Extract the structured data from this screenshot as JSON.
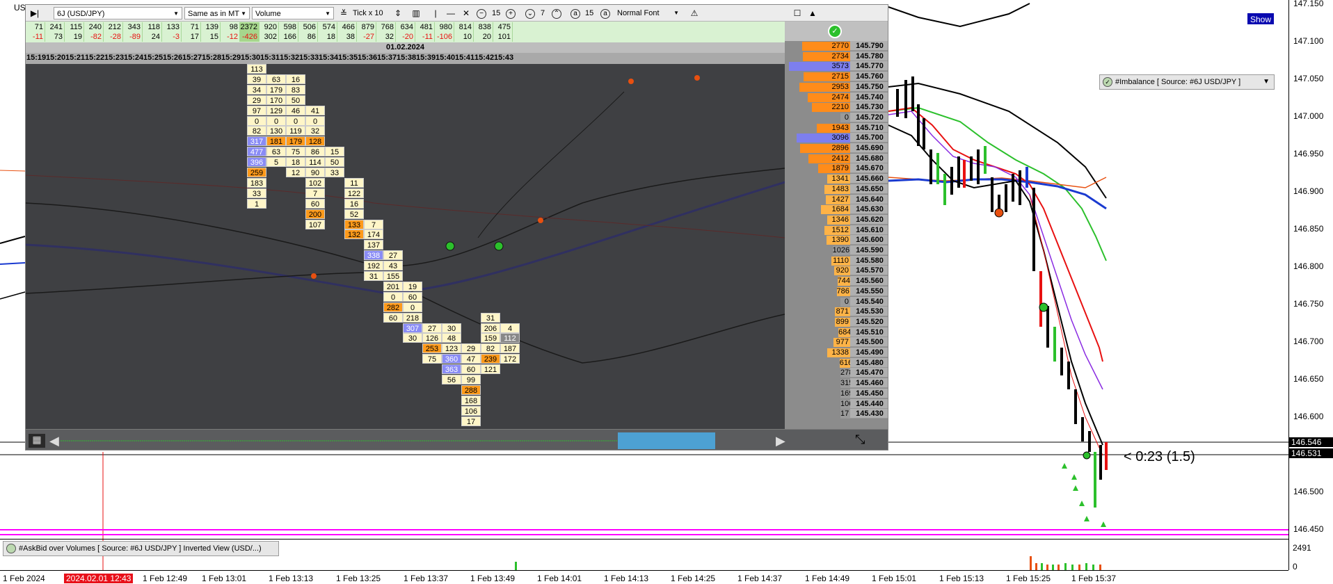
{
  "main": {
    "symbol_fragment": "US",
    "show_label": "Show",
    "imbalance_label": "#Imbalance [ Source: #6J USD/JPY ]",
    "countdown": "< 0:23 (1.5)",
    "bid_price_tag": "146.546",
    "ask_price_tag": "146.531",
    "price_axis": [
      "147.150",
      "147.100",
      "147.050",
      "147.000",
      "146.950",
      "146.900",
      "146.850",
      "146.800",
      "146.750",
      "146.700",
      "146.650",
      "146.600",
      "146.550",
      "146.500",
      "146.450"
    ],
    "time_axis": [
      {
        "label": "1 Feb 2024",
        "highlight": false
      },
      {
        "label": "2024.02.01 12:43",
        "highlight": true
      },
      {
        "label": "1 Feb 12:49",
        "highlight": false
      },
      {
        "label": "1 Feb 13:01",
        "highlight": false
      },
      {
        "label": "1 Feb 13:13",
        "highlight": false
      },
      {
        "label": "1 Feb 13:25",
        "highlight": false
      },
      {
        "label": "1 Feb 13:37",
        "highlight": false
      },
      {
        "label": "1 Feb 13:49",
        "highlight": false
      },
      {
        "label": "1 Feb 14:01",
        "highlight": false
      },
      {
        "label": "1 Feb 14:13",
        "highlight": false
      },
      {
        "label": "1 Feb 14:25",
        "highlight": false
      },
      {
        "label": "1 Feb 14:37",
        "highlight": false
      },
      {
        "label": "1 Feb 14:49",
        "highlight": false
      },
      {
        "label": "1 Feb 15:01",
        "highlight": false
      },
      {
        "label": "1 Feb 15:13",
        "highlight": false
      },
      {
        "label": "1 Feb 15:25",
        "highlight": false
      },
      {
        "label": "1 Feb 15:37",
        "highlight": false
      }
    ],
    "sub_indicator_label": "#AskBid over Volumes [ Source: #6J USD/JPY ] Inverted View (USD/...)",
    "sub_axis": [
      "2491",
      "0"
    ],
    "colors": {
      "sma_black": "#000000",
      "ma_red": "#e81010",
      "ma_green": "#2cc02c",
      "ma_blue": "#1a3ad0",
      "ma_purple": "#8a2be2",
      "ma_orange": "#e85010",
      "magenta": "#ff00ff"
    }
  },
  "panel": {
    "toolbar": {
      "symbol": "6J (USD/JPY)",
      "mode": "Same as in MT",
      "view": "Volume",
      "tick": "Tick x 10",
      "zoom_a": "15",
      "zoom_b": "7",
      "zoom_c": "15",
      "font": "Normal Font"
    },
    "delta_row1": [
      "71",
      "241",
      "115",
      "240",
      "212",
      "343",
      "118",
      "133",
      "71",
      "139",
      "98",
      "2372",
      "920",
      "598",
      "506",
      "574",
      "466",
      "879",
      "768",
      "634",
      "481",
      "980",
      "814",
      "838",
      "475"
    ],
    "delta_row2": [
      "-11",
      "73",
      "19",
      "-82",
      "-28",
      "-89",
      "24",
      "-3",
      "17",
      "15",
      "-12",
      "-426",
      "302",
      "166",
      "86",
      "18",
      "38",
      "-27",
      "32",
      "-20",
      "-11",
      "-106",
      "10",
      "20",
      "101"
    ],
    "date": "01.02.2024",
    "times": [
      "15:19",
      "15:20",
      "15:21",
      "15:22",
      "15:23",
      "15:24",
      "15:25",
      "15:26",
      "15:27",
      "15:28",
      "15:29",
      "15:30",
      "15:31",
      "15:32",
      "15:33",
      "15:34",
      "15:35",
      "15:36",
      "15:37",
      "15:38",
      "15:39",
      "15:40",
      "15:41",
      "15:42",
      "15:43"
    ],
    "footprint": [
      {
        "col": 11,
        "cells": [
          [
            "113",
            "c"
          ],
          [
            "39",
            "c"
          ],
          [
            "34",
            "c"
          ],
          [
            "29",
            "c"
          ],
          [
            "97",
            "c"
          ],
          [
            "0",
            "c"
          ],
          [
            "82",
            "c"
          ],
          [
            "317",
            "b"
          ],
          [
            "477",
            "b"
          ],
          [
            "396",
            "b"
          ],
          [
            "259",
            "o"
          ],
          [
            "183",
            "c"
          ],
          [
            "33",
            "c"
          ],
          [
            "1",
            "c"
          ]
        ]
      },
      {
        "col": 12,
        "cells": [
          [
            "63",
            "c"
          ],
          [
            "179",
            "c"
          ],
          [
            "170",
            "c"
          ],
          [
            "129",
            "c"
          ],
          [
            "0",
            "c"
          ],
          [
            "130",
            "c"
          ],
          [
            "181",
            "o"
          ],
          [
            "63",
            "c"
          ],
          [
            "5",
            "c"
          ],
          [
            "",
            ""
          ],
          [
            "",
            ""
          ],
          [
            "",
            ""
          ]
        ],
        "start": 1
      },
      {
        "col": 13,
        "cells": [
          [
            "16",
            "c"
          ],
          [
            "83",
            "c"
          ],
          [
            "50",
            "c"
          ],
          [
            "46",
            "c"
          ],
          [
            "0",
            "c"
          ],
          [
            "119",
            "c"
          ],
          [
            "179",
            "o"
          ],
          [
            "75",
            "c"
          ],
          [
            "18",
            "c"
          ],
          [
            "12",
            "c"
          ]
        ],
        "start": 1
      },
      {
        "col": 14,
        "cells": [
          [
            "41",
            "c"
          ],
          [
            "0",
            "c"
          ],
          [
            "32",
            "c"
          ],
          [
            "128",
            "o"
          ],
          [
            "86",
            "c"
          ],
          [
            "114",
            "c"
          ],
          [
            "90",
            "c"
          ],
          [
            "102",
            "c"
          ],
          [
            "7",
            "c"
          ],
          [
            "60",
            "c"
          ],
          [
            "200",
            "o"
          ],
          [
            "107",
            "c"
          ]
        ],
        "start": 4
      },
      {
        "col": 15,
        "cells": [
          [
            "15",
            "c"
          ],
          [
            "50",
            "c"
          ],
          [
            "33",
            "c"
          ]
        ],
        "start": 8
      },
      {
        "col": 16,
        "cells": [
          [
            "11",
            "c"
          ],
          [
            "122",
            "c"
          ],
          [
            "16",
            "c"
          ],
          [
            "52",
            "c"
          ],
          [
            "133",
            "o"
          ],
          [
            "132",
            "o"
          ]
        ],
        "start": 11
      },
      {
        "col": 17,
        "cells": [
          [
            "7",
            "c"
          ],
          [
            "174",
            "c"
          ],
          [
            "137",
            "c"
          ],
          [
            "338",
            "b"
          ],
          [
            "192",
            "c"
          ],
          [
            "31",
            "c"
          ]
        ],
        "start": 15
      },
      {
        "col": 18,
        "cells": [
          [
            "27",
            "c"
          ],
          [
            "43",
            "c"
          ],
          [
            "155",
            "c"
          ],
          [
            "201",
            "c"
          ],
          [
            "0",
            "c"
          ],
          [
            "282",
            "o"
          ],
          [
            "60",
            "c"
          ]
        ],
        "start": 18
      },
      {
        "col": 19,
        "cells": [
          [
            "19",
            "c"
          ],
          [
            "60",
            "c"
          ],
          [
            "0",
            "c"
          ],
          [
            "218",
            "c"
          ],
          [
            "307",
            "b"
          ],
          [
            "30",
            "c"
          ]
        ],
        "start": 21
      },
      {
        "col": 20,
        "cells": [
          [
            "27",
            "c"
          ],
          [
            "126",
            "c"
          ],
          [
            "253",
            "o"
          ],
          [
            "75",
            "c"
          ]
        ],
        "start": 25
      },
      {
        "col": 21,
        "cells": [
          [
            "30",
            "c"
          ],
          [
            "48",
            "c"
          ],
          [
            "123",
            "c"
          ],
          [
            "360",
            "b"
          ],
          [
            "363",
            "b"
          ],
          [
            "56",
            "c"
          ]
        ],
        "start": 25
      },
      {
        "col": 22,
        "cells": [
          [
            "29",
            "c"
          ],
          [
            "47",
            "c"
          ],
          [
            "60",
            "c"
          ],
          [
            "99",
            "c"
          ],
          [
            "288",
            "o"
          ],
          [
            "168",
            "c"
          ],
          [
            "106",
            "c"
          ],
          [
            "17",
            "c"
          ]
        ],
        "start": 27
      },
      {
        "col": 23,
        "cells": [
          [
            "31",
            "c"
          ],
          [
            "206",
            "c"
          ],
          [
            "159",
            "c"
          ],
          [
            "82",
            "c"
          ],
          [
            "239",
            "o"
          ],
          [
            "121",
            "c"
          ]
        ],
        "start": 24
      },
      {
        "col": 24,
        "cells": [
          [
            "4",
            "c"
          ],
          [
            "112",
            "g"
          ],
          [
            "187",
            "c"
          ],
          [
            "172",
            "c"
          ]
        ],
        "start": 25
      }
    ],
    "dom": [
      [
        "2770",
        "o",
        "145.790"
      ],
      [
        "2734",
        "o",
        "145.780"
      ],
      [
        "3573",
        "b",
        "145.770"
      ],
      [
        "2715",
        "o",
        "145.760"
      ],
      [
        "2953",
        "o",
        "145.750"
      ],
      [
        "2474",
        "o",
        "145.740"
      ],
      [
        "2210",
        "o",
        "145.730"
      ],
      [
        "0",
        "g",
        "145.720"
      ],
      [
        "1943",
        "o",
        "145.710"
      ],
      [
        "3096",
        "b",
        "145.700"
      ],
      [
        "2896",
        "o",
        "145.690"
      ],
      [
        "2412",
        "o",
        "145.680"
      ],
      [
        "1879",
        "o",
        "145.670"
      ],
      [
        "1341",
        "l",
        "145.660"
      ],
      [
        "1483",
        "l",
        "145.650"
      ],
      [
        "1427",
        "l",
        "145.640"
      ],
      [
        "1684",
        "l",
        "145.630"
      ],
      [
        "1346",
        "l",
        "145.620"
      ],
      [
        "1512",
        "l",
        "145.610"
      ],
      [
        "1390",
        "l",
        "145.600"
      ],
      [
        "1026",
        "g",
        "145.590"
      ],
      [
        "1110",
        "l",
        "145.580"
      ],
      [
        "920",
        "l",
        "145.570"
      ],
      [
        "744",
        "l",
        "145.560"
      ],
      [
        "786",
        "l",
        "145.550"
      ],
      [
        "0",
        "g",
        "145.540"
      ],
      [
        "871",
        "l",
        "145.530"
      ],
      [
        "899",
        "l",
        "145.520"
      ],
      [
        "684",
        "l",
        "145.510"
      ],
      [
        "977",
        "l",
        "145.500"
      ],
      [
        "1338",
        "l",
        "145.490"
      ],
      [
        "616",
        "l",
        "145.480"
      ],
      [
        "278",
        "g",
        "145.470"
      ],
      [
        "315",
        "g",
        "145.460"
      ],
      [
        "169",
        "g",
        "145.450"
      ],
      [
        "106",
        "g",
        "145.440"
      ],
      [
        "17",
        "g",
        "145.430"
      ]
    ]
  }
}
